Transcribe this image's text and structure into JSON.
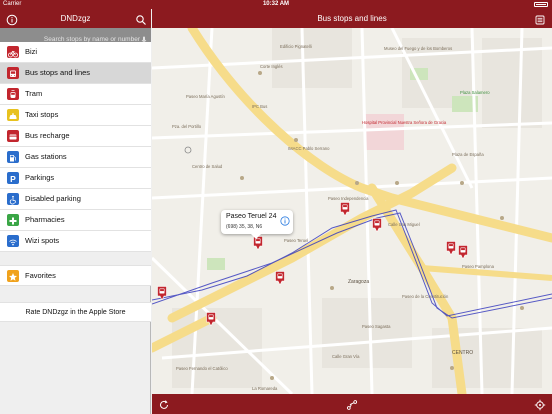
{
  "status_bar": {
    "carrier": "Carrier",
    "time": "10:32 AM"
  },
  "sidebar": {
    "title": "DNDzgz",
    "search_placeholder": "Search stops by name or number",
    "items": [
      {
        "label": "Bizi",
        "icon": "bike-icon",
        "color": "#c2262e"
      },
      {
        "label": "Bus stops and lines",
        "icon": "bus-icon",
        "color": "#c2262e",
        "active": true
      },
      {
        "label": "Tram",
        "icon": "tram-icon",
        "color": "#c2262e"
      },
      {
        "label": "Taxi stops",
        "icon": "taxi-icon",
        "color": "#e8c21f"
      },
      {
        "label": "Bus recharge",
        "icon": "bus-recharge-icon",
        "color": "#c2262e"
      },
      {
        "label": "Gas stations",
        "icon": "gas-station-icon",
        "color": "#2a6dcc"
      },
      {
        "label": "Parkings",
        "icon": "parking-icon",
        "color": "#2a6dcc"
      },
      {
        "label": "Disabled parking",
        "icon": "disabled-parking-icon",
        "color": "#2a6dcc"
      },
      {
        "label": "Pharmacies",
        "icon": "pharmacy-icon",
        "color": "#3aa646"
      },
      {
        "label": "Wizi spots",
        "icon": "wifi-icon",
        "color": "#2a6dcc"
      }
    ],
    "favorites": {
      "label": "Favorites",
      "icon": "star-icon",
      "color": "#f0a21c"
    },
    "rate_label": "Rate DNDzgz in the Apple Store"
  },
  "main": {
    "title": "Bus stops and lines",
    "callout": {
      "title": "Paseo Teruel 24",
      "subtitle": "(698) 35, 38, N6"
    }
  },
  "map": {
    "labels": [
      "Edificio Pignatelli",
      "Museo del Fuego y de los Bomberos",
      "Plaza Salamero",
      "Hospital Provincial Nuestra Señora de Gracia",
      "Corte Inglés",
      "Centro de Salud",
      "IMACC Pablo Serrano",
      "IPC Bus",
      "Plaza de España",
      "Paseo Pamplona",
      "Pza. del Portillo",
      "Zaragoza",
      "Paseo María Agustín",
      "Paseo Teruel",
      "CENTRO",
      "Calle San Miguel",
      "Paseo de la Constitución",
      "Paseo Sagasta",
      "Calle Gran Vía",
      "La Romareda",
      "Paseo Fernando el Católico",
      "Paseo Independencia"
    ]
  }
}
